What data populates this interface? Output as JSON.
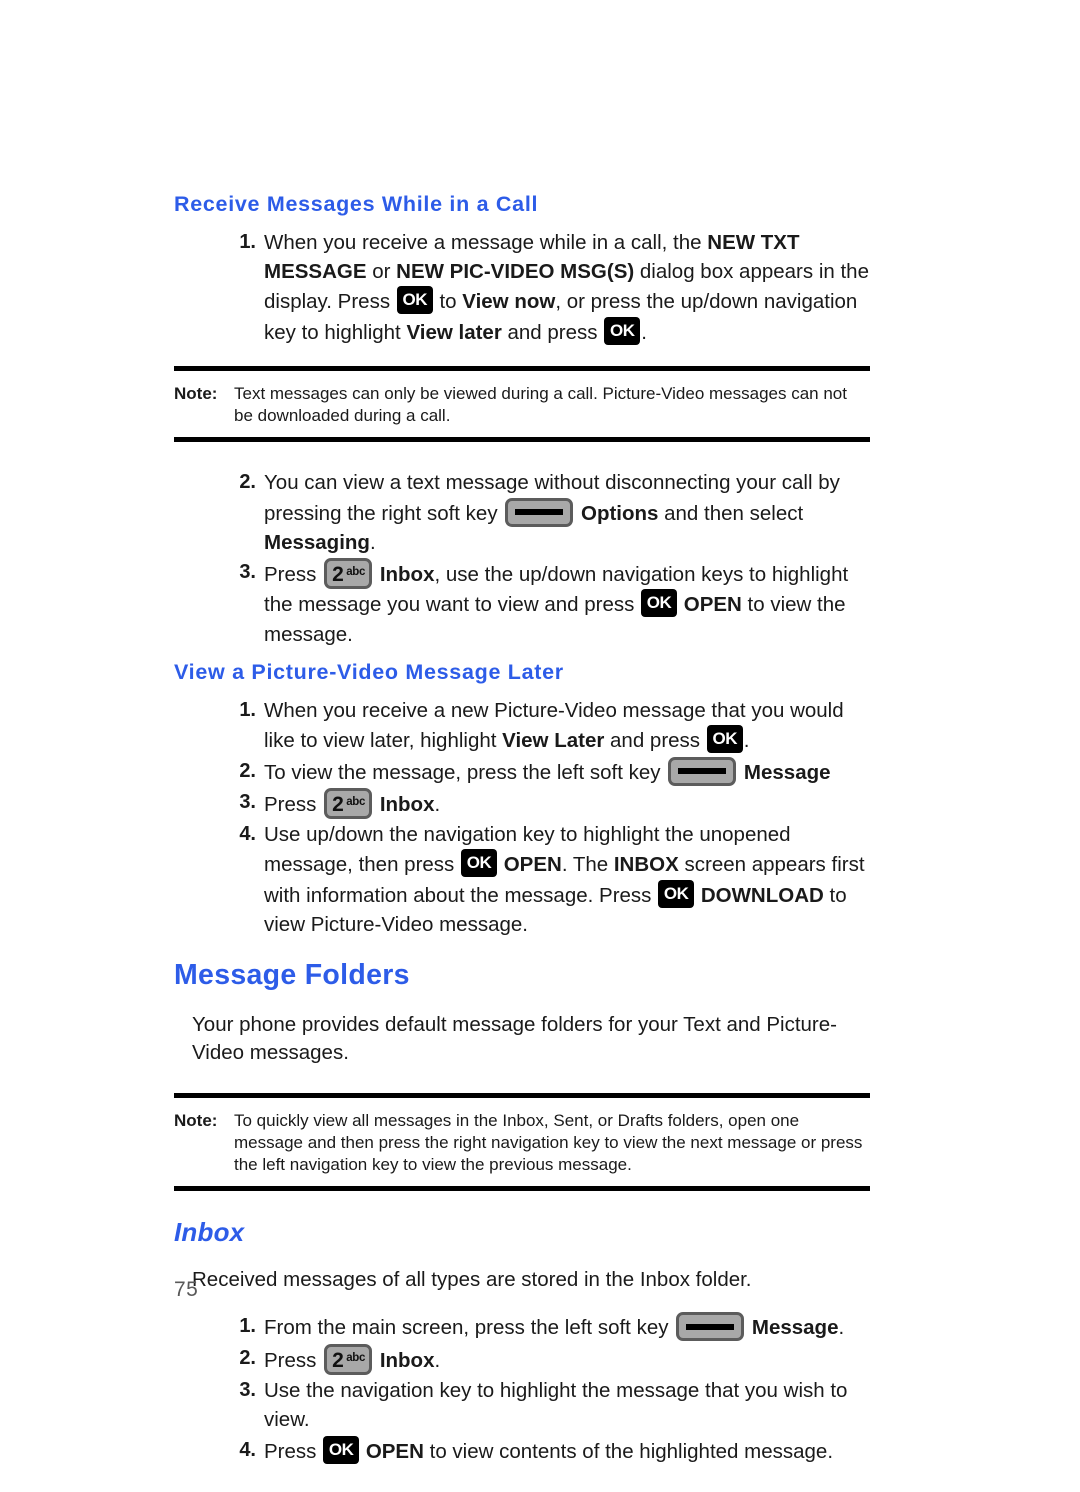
{
  "document": {
    "page_number": "75",
    "heading_color": "#2d5ce8"
  },
  "sections": [
    {
      "id": "receive-messages-while-in-a-call",
      "heading": "Receive Messages While in a Call",
      "steps": [
        {
          "number": "1.",
          "parts": [
            {
              "type": "text",
              "value": "When you receive a message while in a call, the "
            },
            {
              "type": "bold",
              "value": "NEW TXT MESSAGE"
            },
            {
              "type": "text",
              "value": " or "
            },
            {
              "type": "bold",
              "value": "NEW PIC-VIDEO MSG(S)"
            },
            {
              "type": "text",
              "value": " dialog box appears in the display.  Press "
            },
            {
              "type": "key-ok",
              "value": "OK"
            },
            {
              "type": "text",
              "value": " to "
            },
            {
              "type": "bold",
              "value": "View now"
            },
            {
              "type": "text",
              "value": ", or press the up/down navigation key to highlight "
            },
            {
              "type": "bold",
              "value": "View later"
            },
            {
              "type": "text",
              "value": " and press "
            },
            {
              "type": "key-ok",
              "value": "OK"
            },
            {
              "type": "text",
              "value": "."
            }
          ]
        }
      ]
    }
  ],
  "note_1": {
    "label": "Note:",
    "text": "Text messages can only be viewed during a call. Picture-Video messages can not be downloaded during a call."
  },
  "steps_continued": [
    {
      "number": "2.",
      "parts": [
        {
          "type": "text",
          "value": "You can view a text message without disconnecting your call by pressing the right soft key "
        },
        {
          "type": "key-soft",
          "value": "soft-key"
        },
        {
          "type": "text",
          "value": " "
        },
        {
          "type": "bold",
          "value": "Options"
        },
        {
          "type": "text",
          "value": " and then select "
        },
        {
          "type": "bold",
          "value": "Messaging"
        },
        {
          "type": "text",
          "value": "."
        }
      ]
    },
    {
      "number": "3.",
      "parts": [
        {
          "type": "text",
          "value": "Press "
        },
        {
          "type": "key-num",
          "value": "2abc"
        },
        {
          "type": "text",
          "value": " "
        },
        {
          "type": "bold",
          "value": "Inbox"
        },
        {
          "type": "text",
          "value": ", use the up/down navigation keys to highlight the message you want to view and press "
        },
        {
          "type": "key-ok",
          "value": "OK"
        },
        {
          "type": "text",
          "value": " "
        },
        {
          "type": "bold",
          "value": "OPEN"
        },
        {
          "type": "text",
          "value": " to view the message."
        }
      ]
    }
  ],
  "section_view_later": {
    "heading": "View a Picture-Video Message Later",
    "steps": [
      {
        "number": "1.",
        "parts": [
          {
            "type": "text",
            "value": "When you receive a new Picture-Video message that you would like to view later, highlight "
          },
          {
            "type": "bold",
            "value": "View Later"
          },
          {
            "type": "text",
            "value": " and press "
          },
          {
            "type": "key-ok",
            "value": "OK"
          },
          {
            "type": "text",
            "value": "."
          }
        ]
      },
      {
        "number": "2.",
        "parts": [
          {
            "type": "text",
            "value": "To view the message, press the left soft key "
          },
          {
            "type": "key-soft",
            "value": "soft-key"
          },
          {
            "type": "text",
            "value": " "
          },
          {
            "type": "bold",
            "value": "Message"
          }
        ]
      },
      {
        "number": "3.",
        "parts": [
          {
            "type": "text",
            "value": "Press "
          },
          {
            "type": "key-num",
            "value": "2abc"
          },
          {
            "type": "text",
            "value": " "
          },
          {
            "type": "bold",
            "value": "Inbox"
          },
          {
            "type": "text",
            "value": "."
          }
        ]
      },
      {
        "number": "4.",
        "parts": [
          {
            "type": "text",
            "value": "Use up/down the navigation key to highlight the unopened message, then press "
          },
          {
            "type": "key-ok",
            "value": "OK"
          },
          {
            "type": "text",
            "value": " "
          },
          {
            "type": "bold",
            "value": "OPEN"
          },
          {
            "type": "text",
            "value": ". The "
          },
          {
            "type": "bold",
            "value": "INBOX"
          },
          {
            "type": "text",
            "value": " screen appears first with information about the message. Press "
          },
          {
            "type": "key-ok",
            "value": "OK"
          },
          {
            "type": "text",
            "value": " "
          },
          {
            "type": "bold",
            "value": "DOWNLOAD"
          },
          {
            "type": "text",
            "value": " to view Picture-Video message."
          }
        ]
      }
    ]
  },
  "section_message_folders": {
    "heading": "Message Folders",
    "paragraph": "Your phone provides default message folders for your Text and Picture-Video messages."
  },
  "note_2": {
    "label": "Note:",
    "text": "To quickly view all messages in the Inbox, Sent, or Drafts folders, open one message and then press the right navigation key to view the next message or press the left navigation key to view the previous message."
  },
  "section_inbox": {
    "heading": "Inbox",
    "paragraph": "Received messages of all types are stored in the Inbox folder.",
    "steps": [
      {
        "number": "1.",
        "parts": [
          {
            "type": "text",
            "value": "From the main screen, press the left soft key "
          },
          {
            "type": "key-soft",
            "value": "soft-key"
          },
          {
            "type": "text",
            "value": " "
          },
          {
            "type": "bold",
            "value": "Message"
          },
          {
            "type": "text",
            "value": "."
          }
        ]
      },
      {
        "number": "2.",
        "parts": [
          {
            "type": "text",
            "value": "Press "
          },
          {
            "type": "key-num",
            "value": "2abc"
          },
          {
            "type": "text",
            "value": " "
          },
          {
            "type": "bold",
            "value": "Inbox"
          },
          {
            "type": "text",
            "value": "."
          }
        ]
      },
      {
        "number": "3.",
        "parts": [
          {
            "type": "text",
            "value": "Use the navigation key to highlight the message that you wish to view."
          }
        ]
      },
      {
        "number": "4.",
        "parts": [
          {
            "type": "text",
            "value": "Press "
          },
          {
            "type": "key-ok",
            "value": "OK"
          },
          {
            "type": "text",
            "value": " "
          },
          {
            "type": "bold",
            "value": "OPEN"
          },
          {
            "type": "text",
            "value": " to view contents of the highlighted message."
          }
        ]
      }
    ]
  },
  "keys": {
    "ok_label": "OK",
    "num_digit": "2",
    "num_alpha": "abc"
  }
}
